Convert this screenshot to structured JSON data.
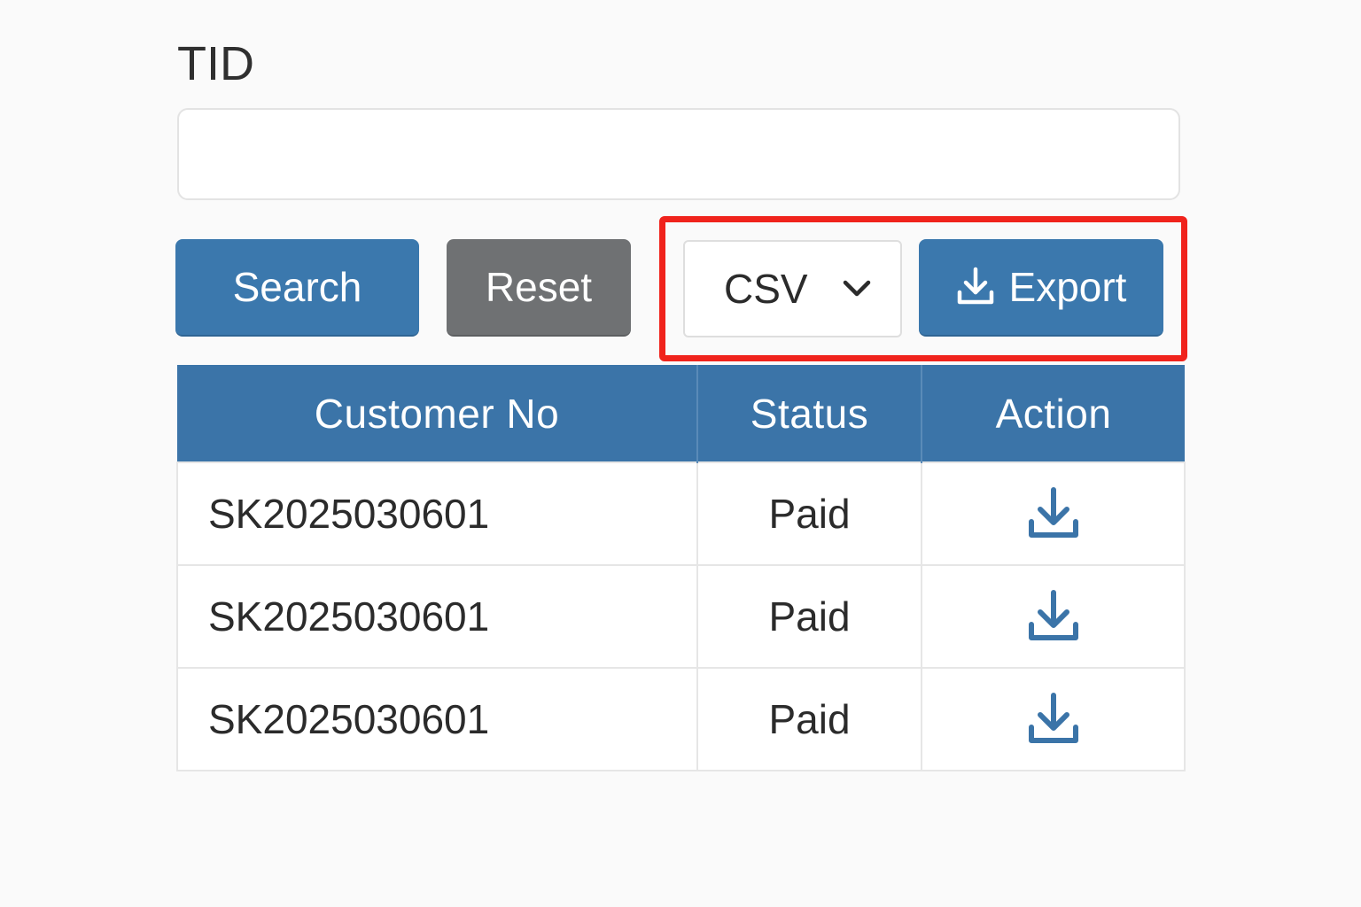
{
  "form": {
    "tid_label": "TID",
    "tid_value": "",
    "tid_placeholder": ""
  },
  "toolbar": {
    "search_label": "Search",
    "reset_label": "Reset",
    "format_selected": "CSV",
    "export_label": "Export",
    "export_icon": "download-icon",
    "highlight_color": "#f0231c"
  },
  "colors": {
    "primary": "#3b78ad",
    "secondary": "#6f7173",
    "header_bg": "#3b74a8"
  },
  "table": {
    "columns": [
      "Customer No",
      "Status",
      "Action"
    ],
    "rows": [
      {
        "customer_no": "SK2025030601",
        "status": "Paid",
        "action_icon": "download-icon"
      },
      {
        "customer_no": "SK2025030601",
        "status": "Paid",
        "action_icon": "download-icon"
      },
      {
        "customer_no": "SK2025030601",
        "status": "Paid",
        "action_icon": "download-icon"
      }
    ]
  }
}
